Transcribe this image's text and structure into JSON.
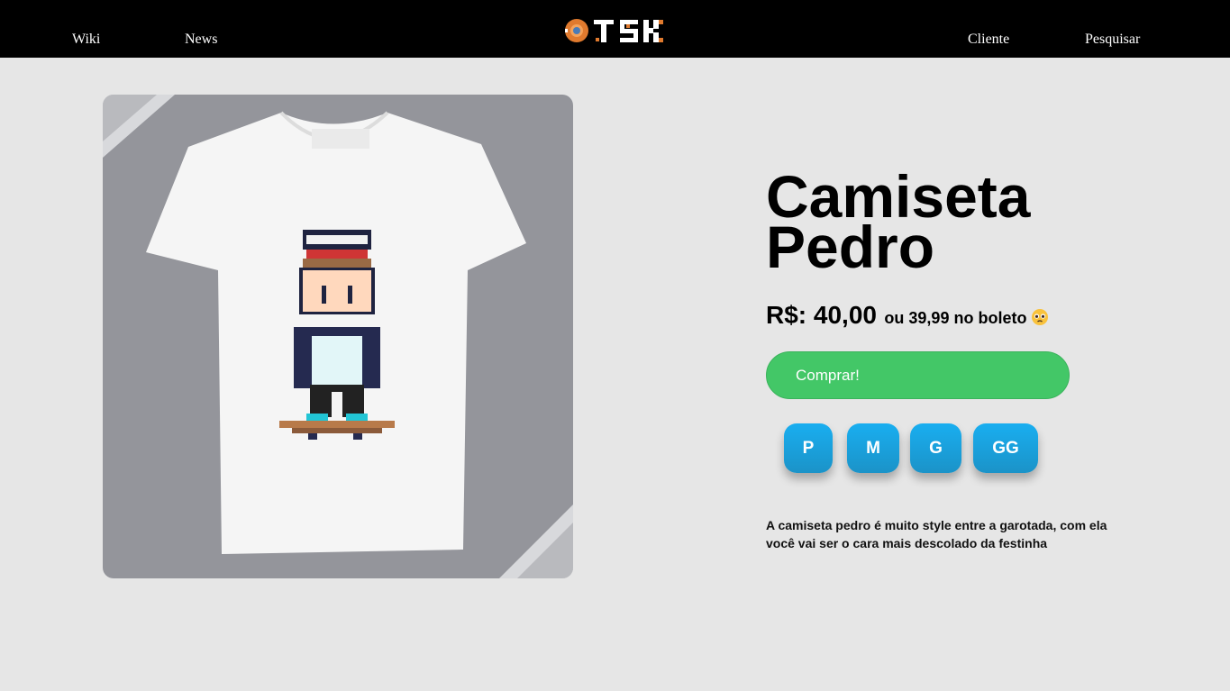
{
  "nav": {
    "left": [
      "Wiki",
      "News"
    ],
    "right": [
      "Cliente",
      "Pesquisar"
    ],
    "logo_text": "OTSK"
  },
  "product": {
    "title_line1": "Camiseta",
    "title_line2": "Pedro",
    "price": "R$: 40,00",
    "alt_price": "ou 39,99 no boleto",
    "emoji": "pleading-face-emoji",
    "buy_label": "Comprar!",
    "sizes": [
      "P",
      "M",
      "G",
      "GG"
    ],
    "description": "A camiseta pedro é muito style entre a garotada, com ela você vai ser o cara mais descolado da festinha"
  },
  "colors": {
    "topbar": "#000000",
    "page_bg": "#e6e6e6",
    "buy_button": "#43c767",
    "size_button": "#19aef0"
  }
}
